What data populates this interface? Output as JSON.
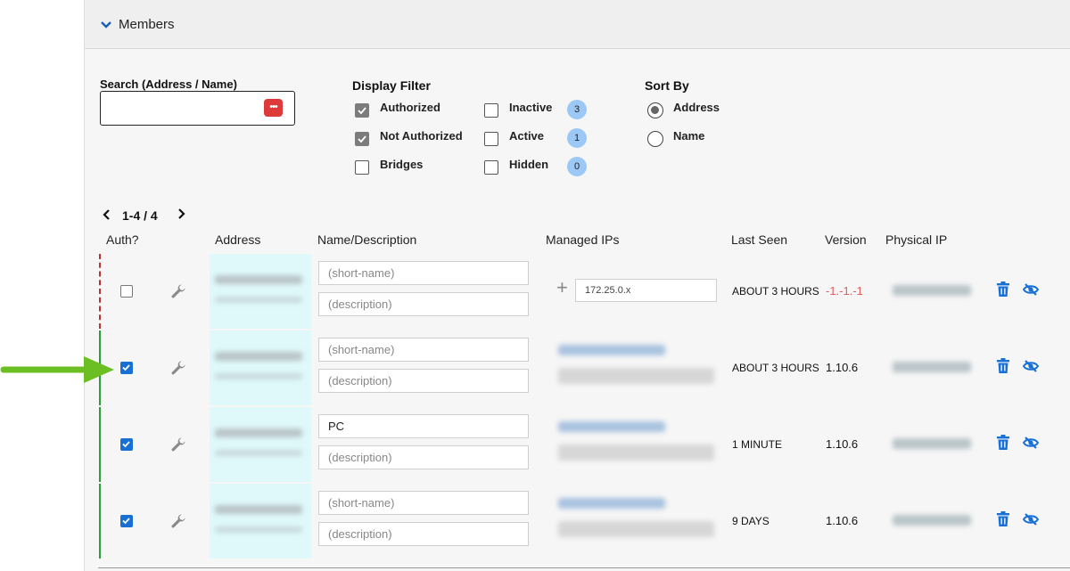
{
  "members": {
    "title": "Members",
    "search": {
      "label": "Search (Address / Name)",
      "value": "",
      "placeholder": ""
    },
    "display_filter": {
      "title": "Display Filter",
      "options": [
        {
          "label": "Authorized",
          "checked": true
        },
        {
          "label": "Not Authorized",
          "checked": true
        },
        {
          "label": "Bridges",
          "checked": false
        },
        {
          "label": "Inactive",
          "checked": false,
          "count": "3"
        },
        {
          "label": "Active",
          "checked": false,
          "count": "1"
        },
        {
          "label": "Hidden",
          "checked": false,
          "count": "0"
        }
      ]
    },
    "sort_by": {
      "title": "Sort By",
      "options": [
        {
          "label": "Address",
          "selected": true
        },
        {
          "label": "Name",
          "selected": false
        }
      ]
    },
    "pagination": {
      "range": "1-4 / 4"
    },
    "columns": [
      "Auth?",
      "Address",
      "Name/Description",
      "Managed IPs",
      "Last Seen",
      "Version",
      "Physical IP"
    ],
    "rows": [
      {
        "authorized": false,
        "short_name": "",
        "short_name_placeholder": "(short-name)",
        "description": "",
        "description_placeholder": "(description)",
        "managed_ip_value": "172.25.0.x",
        "last_seen": "ABOUT 3 HOURS",
        "version": "-1.-1.-1"
      },
      {
        "authorized": true,
        "short_name": "",
        "short_name_placeholder": "(short-name)",
        "description": "",
        "description_placeholder": "(description)",
        "last_seen": "ABOUT 3 HOURS",
        "version": "1.10.6"
      },
      {
        "authorized": true,
        "short_name": "PC",
        "short_name_placeholder": "(short-name)",
        "description": "",
        "description_placeholder": "(description)",
        "last_seen": "1 MINUTE",
        "version": "1.10.6"
      },
      {
        "authorized": true,
        "short_name": "",
        "short_name_placeholder": "(short-name)",
        "description": "",
        "description_placeholder": "(description)",
        "last_seen": "9 DAYS",
        "version": "1.10.6"
      }
    ]
  },
  "colors": {
    "accent_blue": "#1870d5",
    "authorized_bar": "#2a9d3a",
    "unauthorized_bar": "#bb3333",
    "address_bg": "#dff9fb",
    "badge_blue": "#9cc8f5",
    "annotation_arrow": "#6cbf22",
    "version_error": "#e06060"
  },
  "icons": [
    "chevron-down-icon",
    "dots-icon",
    "chevron-left-icon",
    "chevron-right-icon",
    "wrench-icon",
    "plus-icon",
    "trash-icon",
    "eye-slash-icon",
    "arrow-right-icon"
  ]
}
